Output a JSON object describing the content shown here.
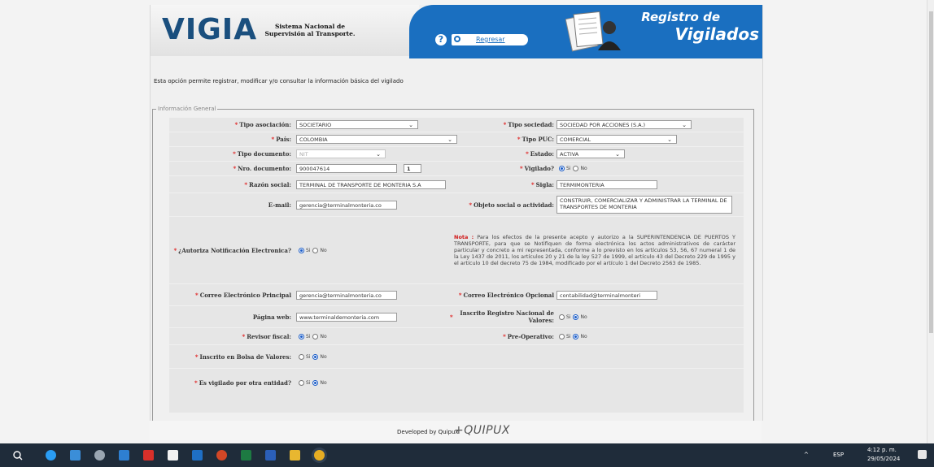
{
  "header": {
    "logo": "VIGIA",
    "logo_subtitle": "Sistema Nacional de Supervisión al Transporte.",
    "help_label": "?",
    "back_label": "Regresar",
    "title_line1": "Registro de",
    "title_line2": "Vigilados"
  },
  "intro_text": "Esta opción permite registrar, modificar y/o consultar la información básica del vigilado",
  "section_legend": "Información General",
  "fields": {
    "tipo_asociacion": {
      "label": "Tipo asociación:",
      "value": "SOCIETARIO"
    },
    "tipo_sociedad": {
      "label": "Tipo sociedad:",
      "value": "SOCIEDAD POR ACCIONES (S.A.)"
    },
    "pais": {
      "label": "País:",
      "value": "COLOMBIA"
    },
    "tipo_puc": {
      "label": "Tipo PUC:",
      "value": "COMERCIAL"
    },
    "tipo_documento": {
      "label": "Tipo documento:",
      "value": "NIT"
    },
    "estado": {
      "label": "Estado:",
      "value": "ACTIVA"
    },
    "nro_documento": {
      "label": "Nro. documento:",
      "value": "900047614",
      "dv": "1"
    },
    "vigilado": {
      "label": "Vigilado?",
      "yes": "Si",
      "no": "No"
    },
    "razon_social": {
      "label": "Razón social:",
      "value": "TERMINAL DE TRANSPORTE DE MONTERIA S.A"
    },
    "sigla": {
      "label": "Sigla:",
      "value": "TERMIMONTERIA"
    },
    "email": {
      "label": "E-mail:",
      "value": "gerencia@terminalmonteria.co"
    },
    "objeto_social": {
      "label": "Objeto social o actividad:",
      "value": "CONSTRUIR, COMERCIALIZAR Y ADMINISTRAR LA TERMINAL DE TRANSPORTES DE MONTERIA"
    },
    "autoriza": {
      "label": "¿Autoriza Notificación Electronica?",
      "yes": "Si",
      "no": "No"
    },
    "nota_title": "Nota :",
    "nota_text": "Para los efectos de la presente acepto y autorizo a la SUPERINTENDENCIA DE PUERTOS Y TRANSPORTE, para que se Notifiquen de forma electrónica los actos administrativos de carácter particular y concreto a mi representada, conforme a lo previsto en los artículos 53, 56, 67 numeral 1 de la Ley 1437 de 2011, los artículos 20 y 21 de la ley 527 de 1999, el artículo 43 del Decreto 229 de 1995 y el artículo 10 del decreto 75 de 1984, modificado por el artículo 1 del Decreto 2563 de 1985.",
    "correo_principal": {
      "label": "Correo Electrónico Principal",
      "value": "gerencia@terminalmonteria.co"
    },
    "correo_opcional": {
      "label": "Correo Electrónico Opcional",
      "value": "contabilidad@terminalmonteri"
    },
    "pagina_web": {
      "label": "Página web:",
      "value": "www.terminaldemonteria.com"
    },
    "inscrito_rnv": {
      "label": "Inscrito Registro Nacional de Valores:",
      "yes": "Si",
      "no": "No"
    },
    "revisor_fiscal": {
      "label": "Revisor fiscal:",
      "yes": "Si",
      "no": "No"
    },
    "pre_operativo": {
      "label": "Pre-Operativo:",
      "yes": "Si",
      "no": "No"
    },
    "inscrito_bolsa": {
      "label": "Inscrito en Bolsa de Valores:",
      "yes": "Si",
      "no": "No"
    },
    "vigilado_otra": {
      "label": "Es vigilado por otra entidad?",
      "yes": "Si",
      "no": "No"
    }
  },
  "footer": {
    "developed_by": "Developed by Quipux",
    "brand": "+QUIPUX"
  },
  "taskbar": {
    "lang": "ESP",
    "time": "4:12 p. m.",
    "date": "29/05/2024"
  }
}
